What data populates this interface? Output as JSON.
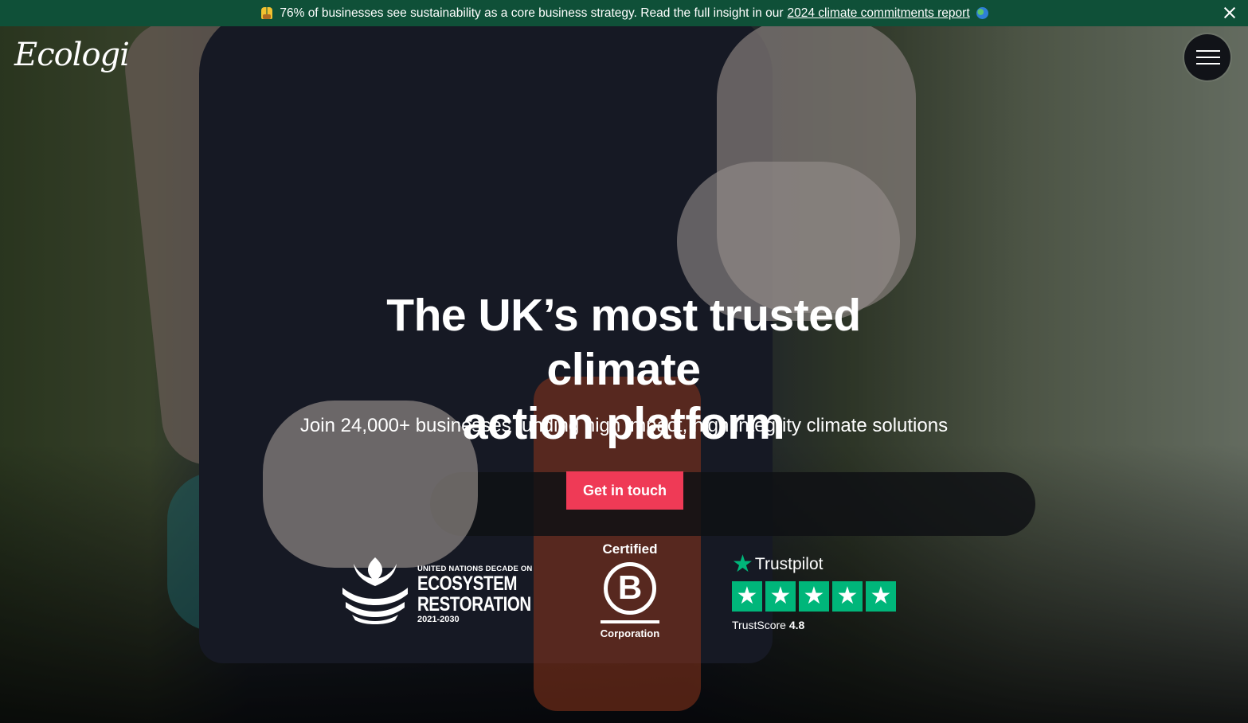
{
  "announcement": {
    "emoji_icon": "raised-hands-icon",
    "text": "76% of businesses see sustainability as a core business strategy. Read the full insight in our",
    "link_text": "2024 climate commitments report",
    "trailing_icon": "globe-icon",
    "close_icon": "close-icon",
    "background_color": "#0f5038"
  },
  "header": {
    "logo_text": "Ecologi",
    "menu_icon": "hamburger-menu-icon"
  },
  "hero": {
    "title_line1": "The UK’s most trusted climate",
    "title_line2": "action platform",
    "subtitle": "Join 24,000+ businesses funding high impact, high integrity climate solutions",
    "cta_label": "Get in touch",
    "cta_color": "#ef3a56"
  },
  "badges": {
    "un_decade": {
      "line1": "UNITED NATIONS DECADE ON",
      "line2": "ECOSYSTEM",
      "line3": "RESTORATION",
      "years": "2021-2030"
    },
    "bcorp": {
      "top": "Certified",
      "letter": "B",
      "bottom": "Corporation"
    },
    "trustpilot": {
      "brand": "Trustpilot",
      "score_label": "TrustScore",
      "score_value": "4.8",
      "stars": 5,
      "star_color": "#00b67a"
    }
  }
}
